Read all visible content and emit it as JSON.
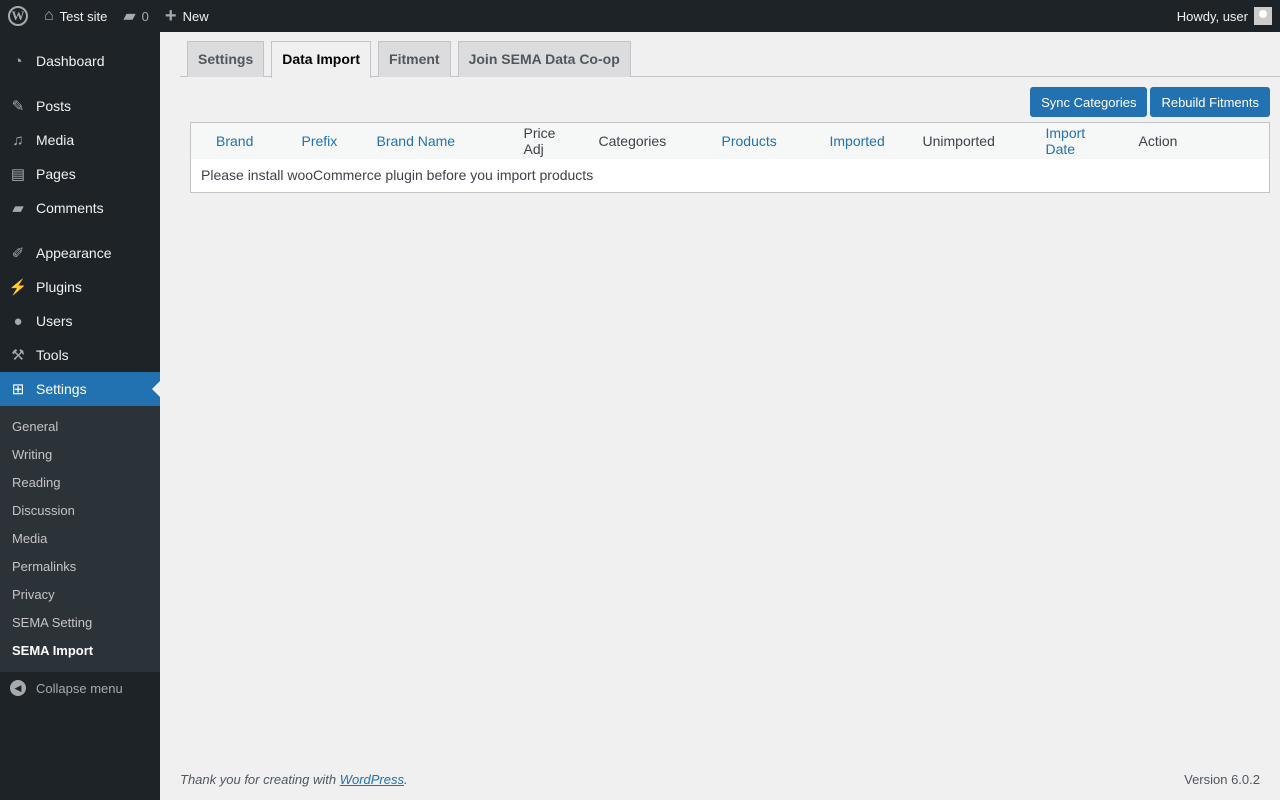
{
  "adminbar": {
    "site": "Test site",
    "comments": "0",
    "new": "New",
    "howdy": "Howdy, user"
  },
  "menu": {
    "dashboard": "Dashboard",
    "posts": "Posts",
    "media": "Media",
    "pages": "Pages",
    "comments": "Comments",
    "appearance": "Appearance",
    "plugins": "Plugins",
    "users": "Users",
    "tools": "Tools",
    "settings": "Settings",
    "sub": [
      "General",
      "Writing",
      "Reading",
      "Discussion",
      "Media",
      "Permalinks",
      "Privacy",
      "SEMA Setting",
      "SEMA Import"
    ],
    "collapse": "Collapse menu"
  },
  "tabs": [
    "Settings",
    "Data Import",
    "Fitment",
    "Join SEMA Data Co-op"
  ],
  "buttons": {
    "sync": "Sync Categories",
    "rebuild": "Rebuild Fitments"
  },
  "table": {
    "headers": [
      "Brand",
      "Prefix",
      "Brand Name",
      "Price Adj",
      "Categories",
      "Products",
      "Imported",
      "Unimported",
      "Import Date",
      "Action"
    ],
    "message": "Please install wooCommerce plugin before you import products"
  },
  "footer": {
    "thanks": "Thank you for creating with ",
    "link": "WordPress",
    "period": ".",
    "version": "Version 6.0.2"
  }
}
